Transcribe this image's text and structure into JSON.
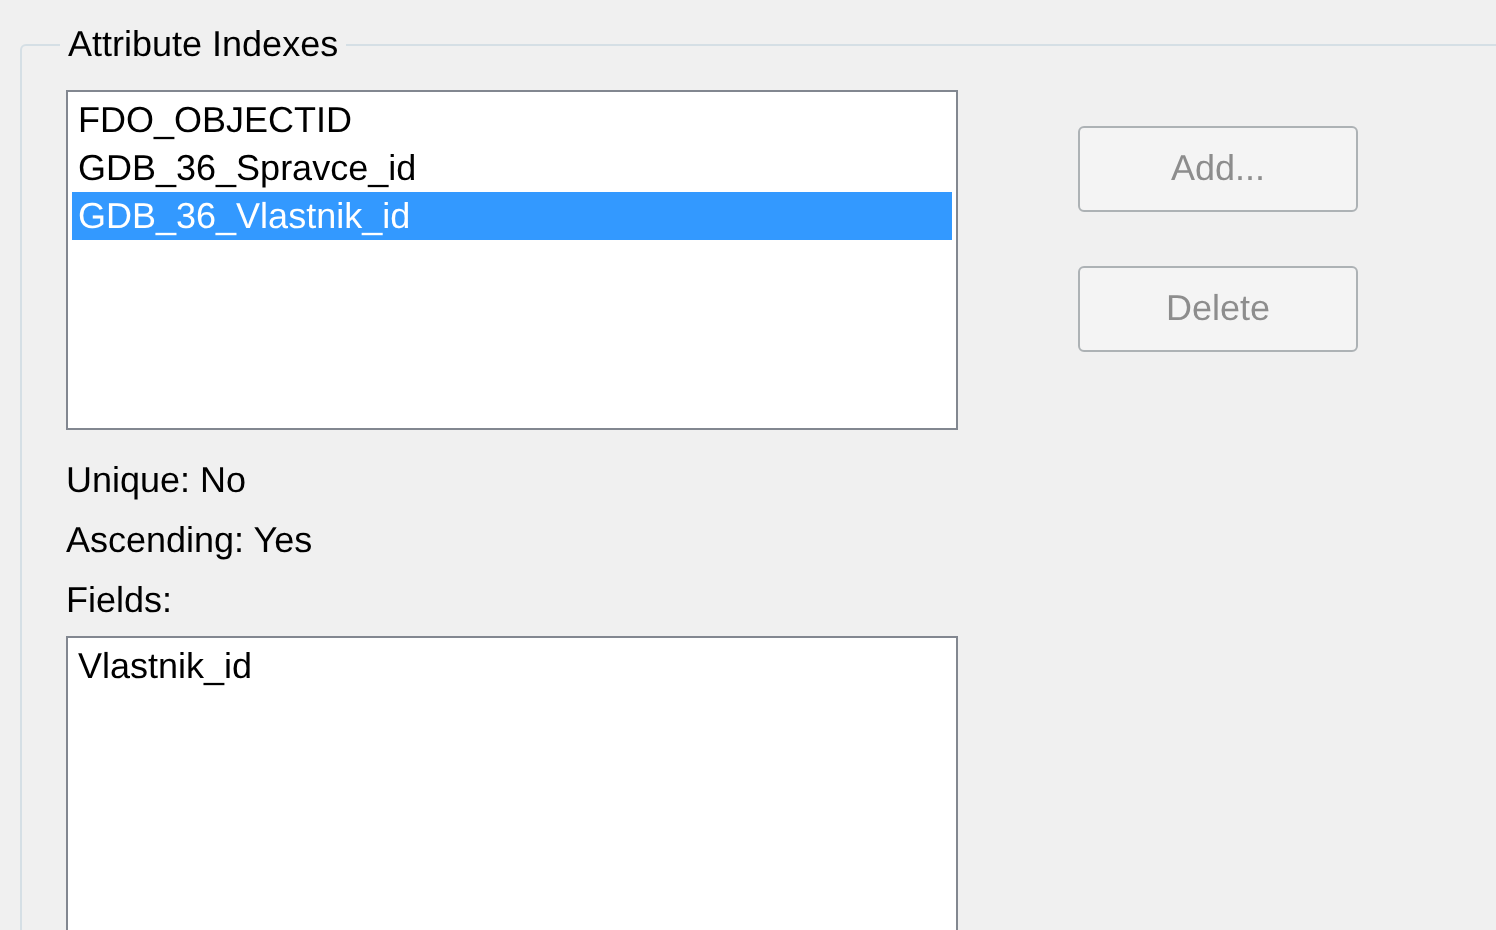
{
  "group": {
    "title": "Attribute Indexes"
  },
  "indexes": [
    {
      "label": "FDO_OBJECTID",
      "selected": false
    },
    {
      "label": "GDB_36_Spravce_id",
      "selected": false
    },
    {
      "label": "GDB_36_Vlastnik_id",
      "selected": true
    }
  ],
  "buttons": [
    {
      "label": "Add...",
      "disabled": true
    },
    {
      "label": "Delete",
      "disabled": true
    }
  ],
  "details": [
    {
      "text": "Unique: No"
    },
    {
      "text": "Ascending: Yes"
    },
    {
      "text": "Fields:"
    }
  ],
  "fields": [
    {
      "label": "Vlastnik_id"
    }
  ]
}
